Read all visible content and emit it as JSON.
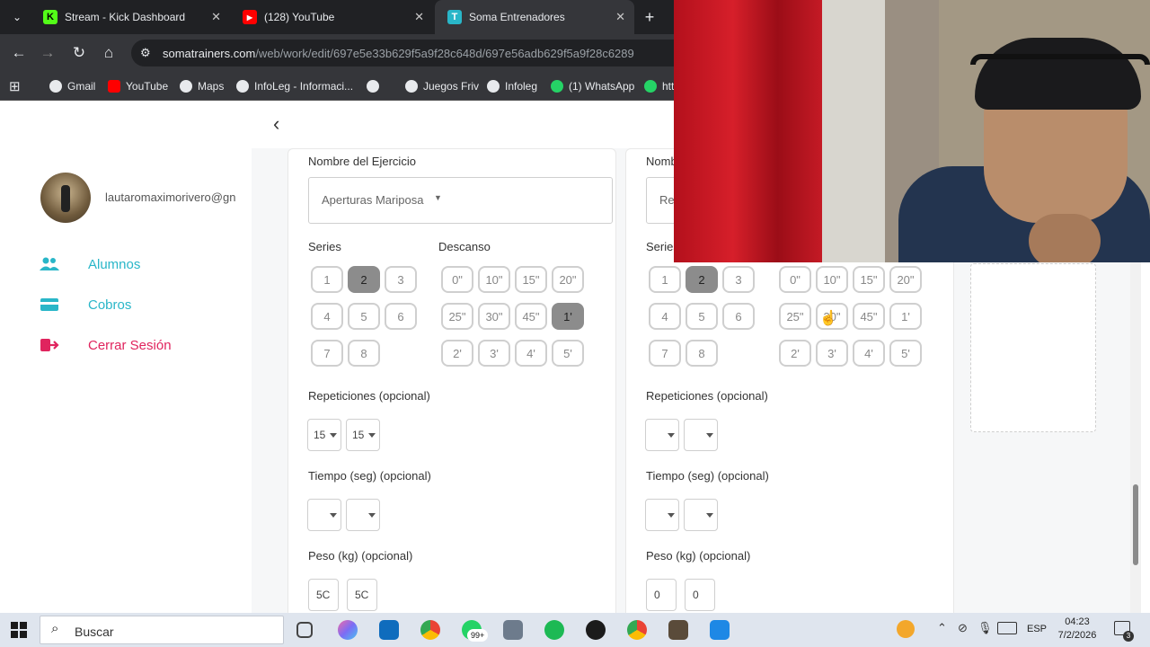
{
  "browser": {
    "tabs": [
      {
        "label": "Stream - Kick Dashboard",
        "icon": "kick-icon",
        "color": "#53fc18",
        "glyph": "K"
      },
      {
        "label": "(128) YouTube",
        "icon": "youtube-icon",
        "color": "#ff0000",
        "glyph": "▶"
      },
      {
        "label": "Soma Entrenadores",
        "icon": "soma-icon",
        "color": "#29b6c8",
        "glyph": "T"
      }
    ],
    "new_tab": "+",
    "url_domain": "somatrainers.com",
    "url_path": "/web/work/edit/697e5e33b629f5a9f28c648d/697e56adb629f5a9f28c6289",
    "bookmarks": [
      "Gmail",
      "YouTube",
      "Maps",
      "InfoLeg - Informaci...",
      "",
      "Juegos Friv",
      "Infoleg",
      "(1) WhatsApp",
      "htt"
    ]
  },
  "sidebar": {
    "user_email": "lautaromaximorivero@gn",
    "items": [
      {
        "label": "Alumnos",
        "icon": "users-icon",
        "color": "#29b6c8"
      },
      {
        "label": "Cobros",
        "icon": "card-icon",
        "color": "#29b6c8"
      },
      {
        "label": "Cerrar Sesión",
        "icon": "logout-icon",
        "color": "#e0245e"
      }
    ]
  },
  "exercise1": {
    "name_label": "Nombre del Ejercicio",
    "name_value": "Aperturas Mariposa",
    "series_label": "Series",
    "series": [
      "1",
      "2",
      "3",
      "4",
      "5",
      "6",
      "7",
      "8"
    ],
    "series_selected": "2",
    "rest_label": "Descanso",
    "rest": [
      "0\"",
      "10\"",
      "15\"",
      "20\"",
      "25\"",
      "30\"",
      "45\"",
      "1'",
      "2'",
      "3'",
      "4'",
      "5'"
    ],
    "rest_selected": "1'",
    "reps_label": "Repeticiones (opcional)",
    "reps": [
      "15",
      "15"
    ],
    "time_label": "Tiempo (seg) (opcional)",
    "time": [
      "",
      ""
    ],
    "weight_label": "Peso (kg) (opcional)",
    "weight": [
      "5C",
      "5C"
    ]
  },
  "exercise2": {
    "name_label": "Nomb",
    "name_value": "Re",
    "series_label": "Series",
    "series": [
      "1",
      "2",
      "3",
      "4",
      "5",
      "6",
      "7",
      "8"
    ],
    "series_selected": "2",
    "rest": [
      "0\"",
      "10\"",
      "15\"",
      "20\"",
      "25\"",
      "30\"",
      "45\"",
      "1'",
      "2'",
      "3'",
      "4'",
      "5'"
    ],
    "reps_label": "Repeticiones (opcional)",
    "reps": [
      "",
      ""
    ],
    "time_label": "Tiempo (seg) (opcional)",
    "time": [
      "",
      ""
    ],
    "weight_label": "Peso (kg) (opcional)",
    "weight": [
      "0",
      "0"
    ]
  },
  "taskbar": {
    "search": "Buscar",
    "badge": "99+",
    "lang": "ESP",
    "time": "04:23",
    "date": "7/2/2026",
    "notif": "3"
  }
}
